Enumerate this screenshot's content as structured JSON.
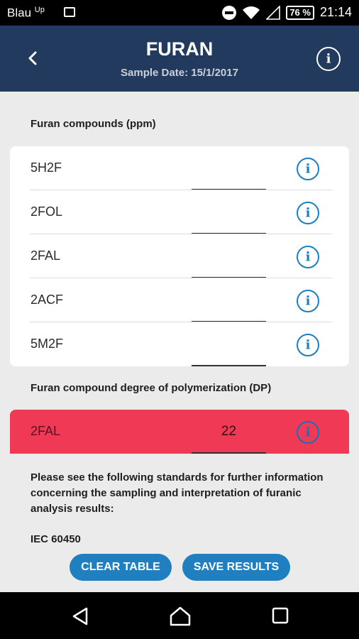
{
  "status_bar": {
    "carrier": "Blau",
    "carrier_suffix": "Up",
    "battery": "76 %",
    "time": "21:14"
  },
  "header": {
    "title": "FURAN",
    "subtitle": "Sample Date: 15/1/2017",
    "background": "#223a5e"
  },
  "furan_section": {
    "label": "Furan compounds (ppm)",
    "rows": [
      {
        "name": "5H2F",
        "value": ""
      },
      {
        "name": "2FOL",
        "value": ""
      },
      {
        "name": "2FAL",
        "value": ""
      },
      {
        "name": "2ACF",
        "value": ""
      },
      {
        "name": "5M2F",
        "value": ""
      }
    ]
  },
  "dp_section": {
    "label": "Furan compound degree of polymerization (DP)",
    "row": {
      "name": "2FAL",
      "value": "22"
    },
    "highlight_color": "#f03a55"
  },
  "note": "Please see the following standards for further information concerning the sampling and interpretation of furanic analysis results:",
  "standard": "IEC 60450",
  "buttons": {
    "clear": "CLEAR TABLE",
    "save": "SAVE RESULTS",
    "color": "#1f7fbf"
  },
  "icons": {
    "back": "chevron-left-icon",
    "info": "info-circle-icon",
    "nav_back": "triangle-back-icon",
    "nav_home": "home-icon",
    "nav_recents": "square-recents-icon"
  }
}
